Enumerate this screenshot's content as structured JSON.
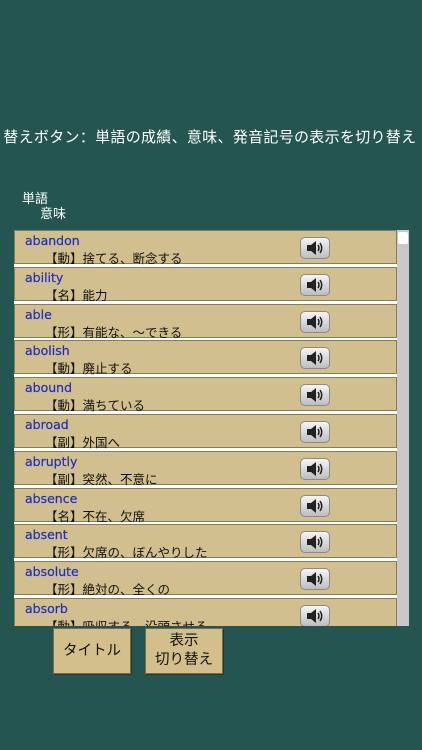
{
  "marquee_text": "り替えボタン：単語の成績、意味、発音記号の表示を切り替え",
  "column_headers": {
    "word": "単語",
    "meaning": "意味"
  },
  "entries": [
    {
      "word": "abandon",
      "meaning": "【動】捨てる、断念する"
    },
    {
      "word": "ability",
      "meaning": "【名】能力"
    },
    {
      "word": "able",
      "meaning": "【形】有能な、～できる"
    },
    {
      "word": "abolish",
      "meaning": "【動】廃止する"
    },
    {
      "word": "abound",
      "meaning": "【動】満ちている"
    },
    {
      "word": "abroad",
      "meaning": "【副】外国へ"
    },
    {
      "word": "abruptly",
      "meaning": "【副】突然、不意に"
    },
    {
      "word": "absence",
      "meaning": "【名】不在、欠席"
    },
    {
      "word": "absent",
      "meaning": "【形】欠席の、ぼんやりした"
    },
    {
      "word": "absolute",
      "meaning": "【形】絶対の、全くの"
    },
    {
      "word": "absorb",
      "meaning": "【動】吸収する、没頭させる"
    }
  ],
  "buttons": {
    "title": "タイトル",
    "toggle_line1": "表示",
    "toggle_line2": "切り替え"
  },
  "icons": {
    "speaker": "speaker-icon"
  },
  "colors": {
    "background": "#245550",
    "row": "#d2bf8f",
    "word_text": "#1d2fbd"
  }
}
